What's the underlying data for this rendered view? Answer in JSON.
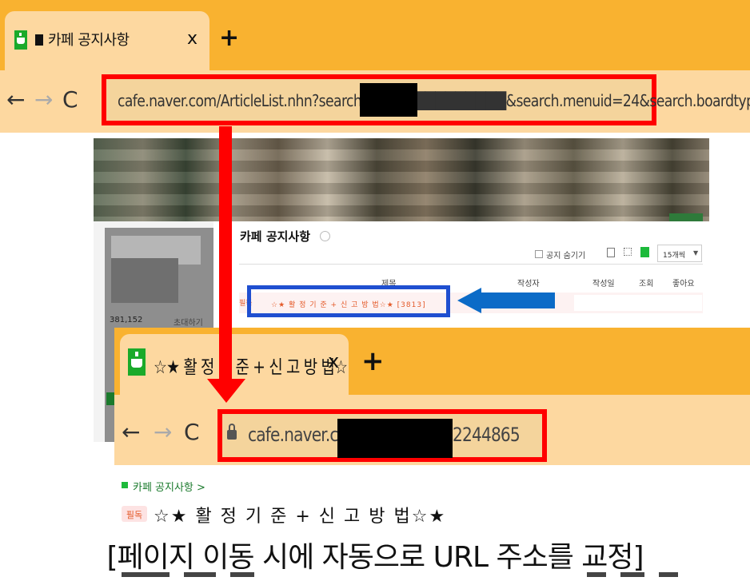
{
  "top_browser": {
    "tab_title": "카페 공지사항",
    "close_glyph": "x",
    "new_tab_glyph": "+",
    "nav": {
      "back": "←",
      "forward": "→",
      "reload": "C"
    },
    "url": "cafe.naver.com/ArticleList.nhn?search.clubid=█████████&search.menuid=24&search.boardtype=L"
  },
  "cafe_page": {
    "board_title": "카페 공지사항",
    "hide_notice_label": "공지 숨기기",
    "per_page": "15개씩",
    "columns": [
      "제목",
      "작성자",
      "작성일",
      "조회",
      "좋아요"
    ],
    "member_count": "381,152",
    "invite_label": "초대하기",
    "row": {
      "tag": "필독",
      "title": "☆★ 활 정 기 준 + 신 고 방 법☆★ [3813]"
    }
  },
  "bottom_browser": {
    "tab_title": "☆★ 활 정 기 준 + 신 고 방 법☆",
    "close_glyph": "x",
    "new_tab_glyph": "+",
    "nav": {
      "back": "←",
      "forward": "→",
      "reload": "C"
    },
    "url_prefix": "cafe.naver.com",
    "url_suffix": "2244865"
  },
  "article": {
    "breadcrumb": "카페 공지사항 >",
    "badge": "필독",
    "title": "☆★ 활 정 기 준 + 신 고 방 법☆★"
  },
  "caption": "[페이지 이동 시에 자동으로 URL 주소를 교정]",
  "colors": {
    "highlight_red": "#ff0000",
    "highlight_blue": "#1f4fd0",
    "arrow_blue": "#0b6bc7",
    "tabbar_orange": "#f9b230",
    "toolbar_beige": "#fdd8a0",
    "naver_green": "#1aaa2a"
  }
}
